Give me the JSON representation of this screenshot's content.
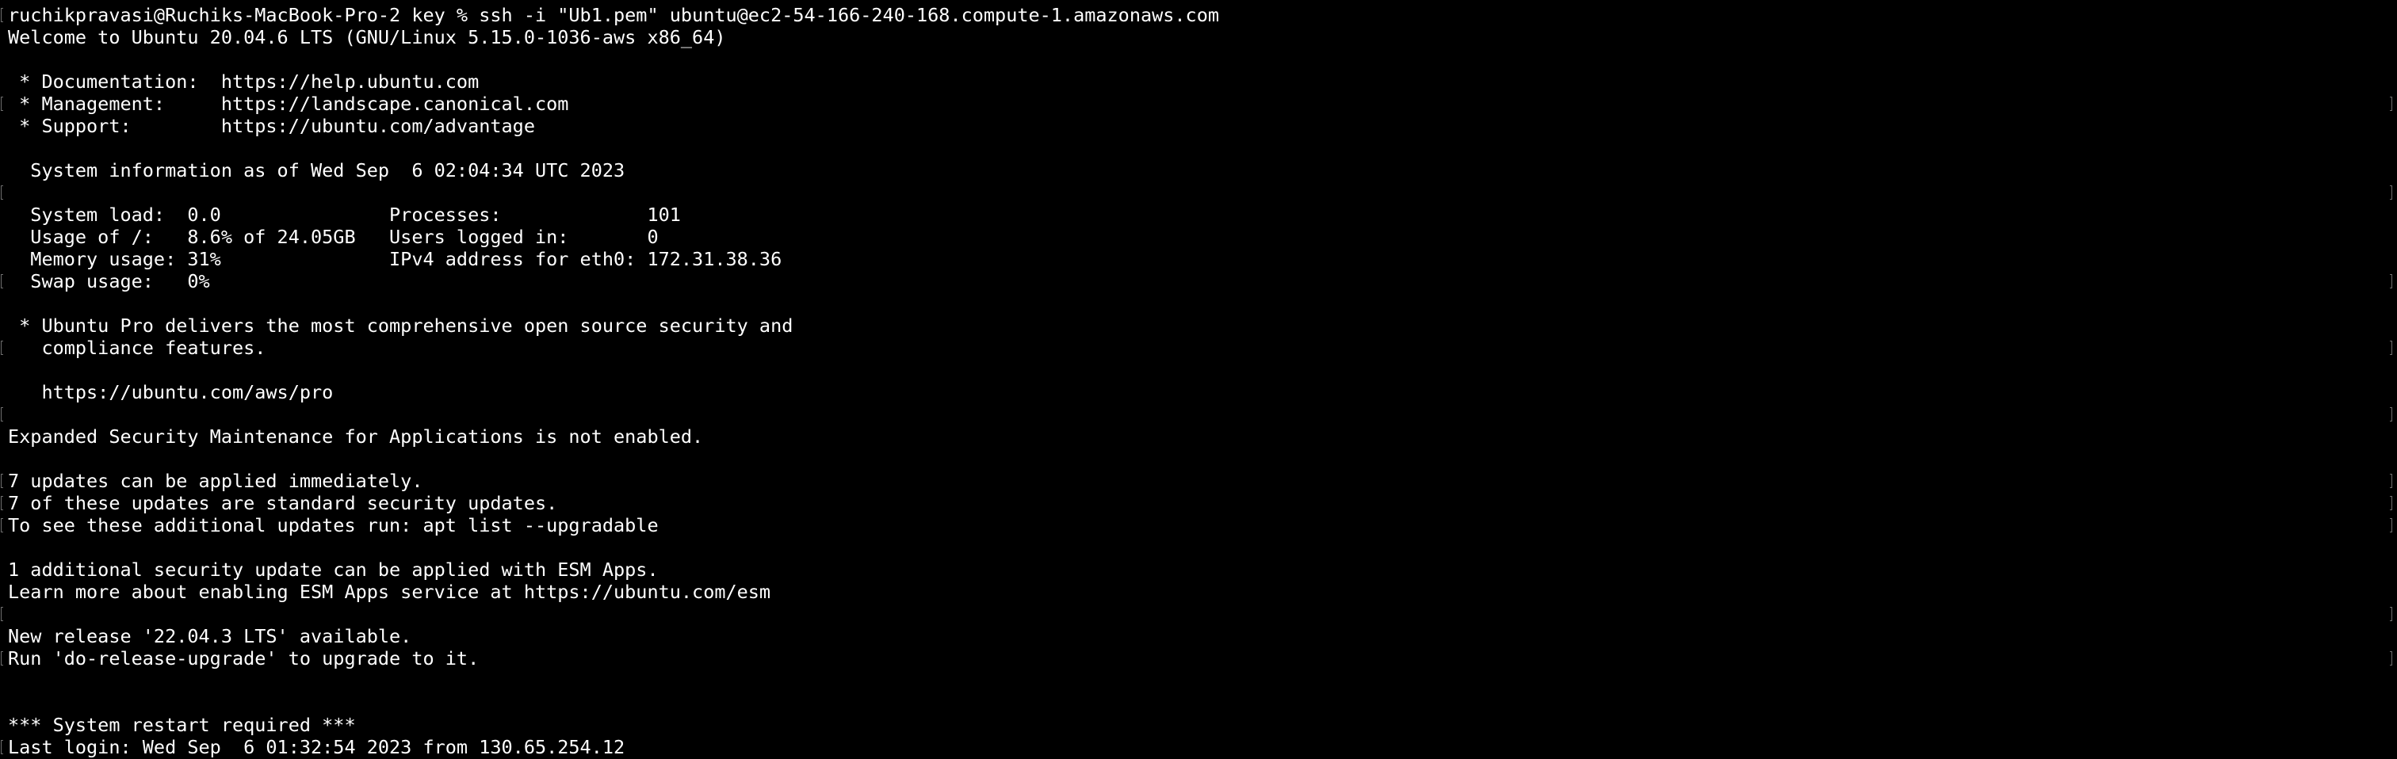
{
  "terminal": {
    "background": "#000000",
    "foreground": "#ffffff",
    "lines": [
      {
        "text": "ruchikpravasi@Ruchiks-MacBook-Pro-2 key % ssh -i \"Ub1.pem\" ubuntu@ec2-54-166-240-168.compute-1.amazonaws.com"
      },
      {
        "text": "Welcome to Ubuntu 20.04.6 LTS (GNU/Linux 5.15.0-1036-aws x86_64)"
      },
      {
        "text": ""
      },
      {
        "text": " * Documentation:  https://help.ubuntu.com"
      },
      {
        "text": " * Management:     https://landscape.canonical.com"
      },
      {
        "text": " * Support:        https://ubuntu.com/advantage"
      },
      {
        "text": ""
      },
      {
        "text": "  System information as of Wed Sep  6 02:04:34 UTC 2023"
      },
      {
        "text": ""
      },
      {
        "text": "  System load:  0.0               Processes:             101"
      },
      {
        "text": "  Usage of /:   8.6% of 24.05GB   Users logged in:       0"
      },
      {
        "text": "  Memory usage: 31%               IPv4 address for eth0: 172.31.38.36"
      },
      {
        "text": "  Swap usage:   0%"
      },
      {
        "text": ""
      },
      {
        "text": " * Ubuntu Pro delivers the most comprehensive open source security and"
      },
      {
        "text": "   compliance features."
      },
      {
        "text": ""
      },
      {
        "text": "   https://ubuntu.com/aws/pro"
      },
      {
        "text": ""
      },
      {
        "text": "Expanded Security Maintenance for Applications is not enabled."
      },
      {
        "text": ""
      },
      {
        "text": "7 updates can be applied immediately."
      },
      {
        "text": "7 of these updates are standard security updates."
      },
      {
        "text": "To see these additional updates run: apt list --upgradable"
      },
      {
        "text": ""
      },
      {
        "text": "1 additional security update can be applied with ESM Apps."
      },
      {
        "text": "Learn more about enabling ESM Apps service at https://ubuntu.com/esm"
      },
      {
        "text": ""
      },
      {
        "text": "New release '22.04.3 LTS' available."
      },
      {
        "text": "Run 'do-release-upgrade' to upgrade to it."
      },
      {
        "text": ""
      },
      {
        "text": ""
      },
      {
        "text": "*** System restart required ***"
      },
      {
        "text": "Last login: Wed Sep  6 01:32:54 2023 from 130.65.254.12"
      }
    ]
  }
}
